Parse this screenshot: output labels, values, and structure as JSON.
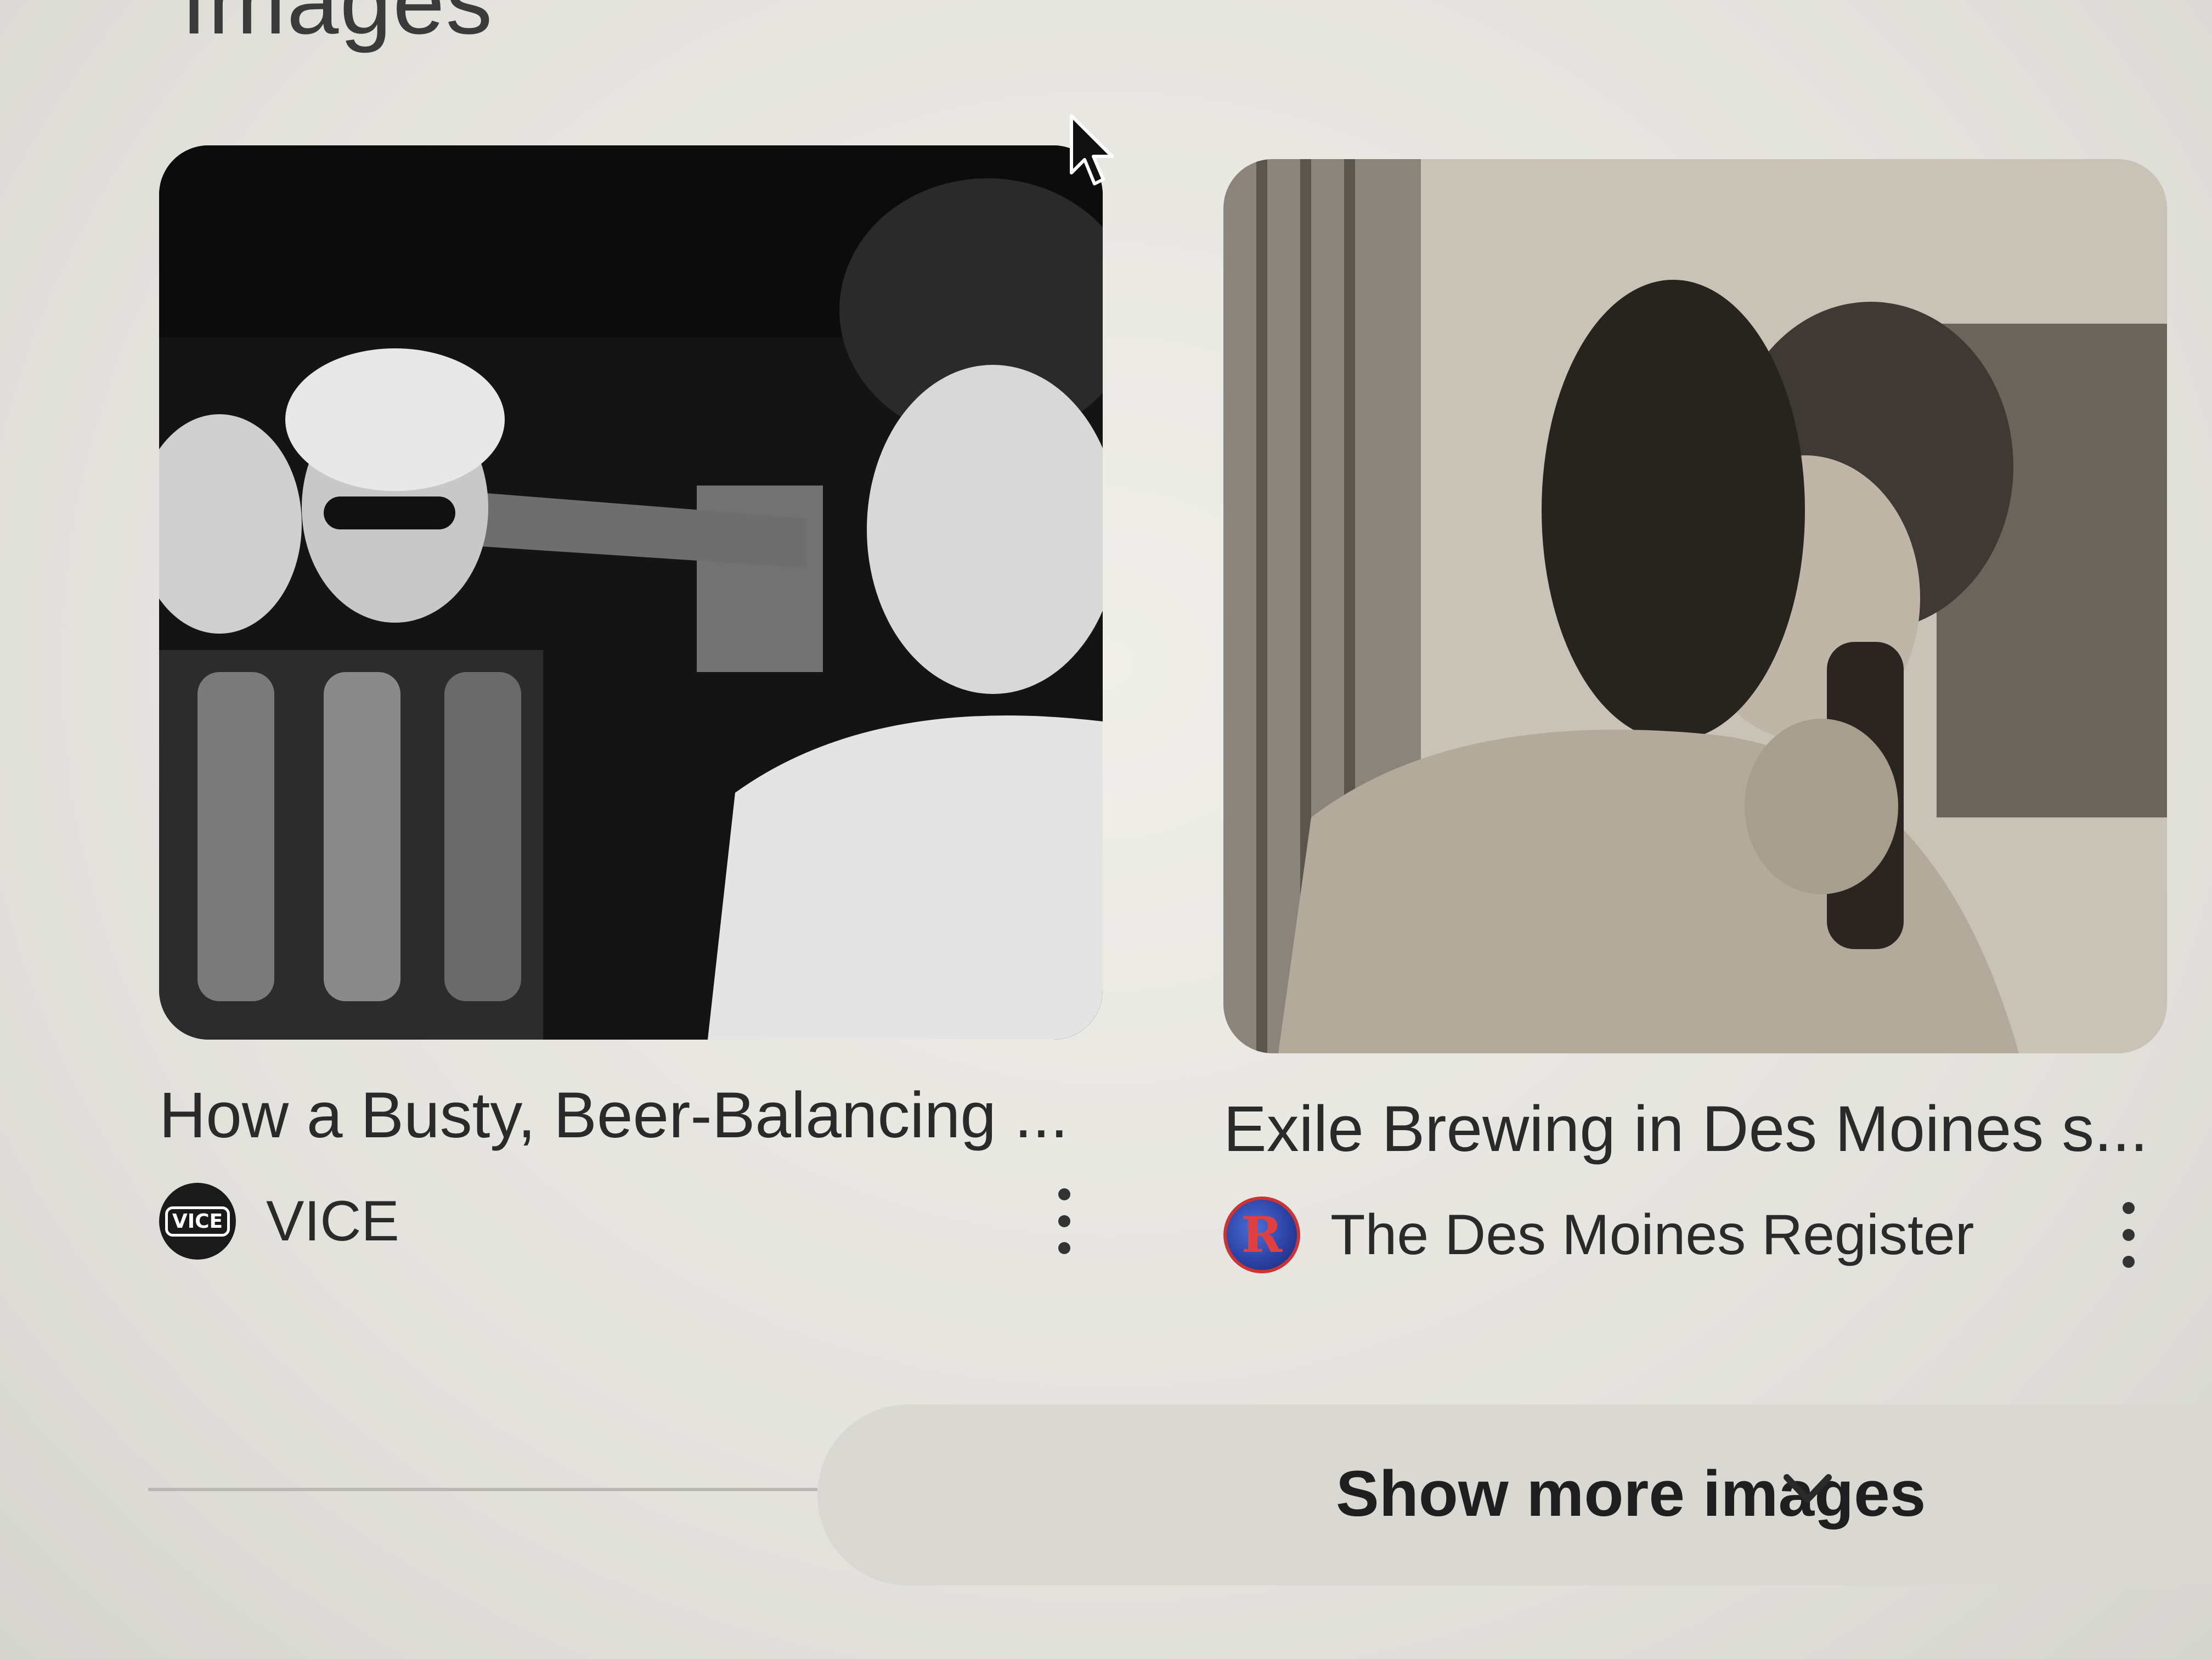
{
  "section": {
    "heading": "Images"
  },
  "results": [
    {
      "title": "How a Busty, Beer-Balancing ...",
      "source": "VICE",
      "favicon_text": "VICE",
      "favicon_icon": "vice-logo-icon"
    },
    {
      "title": "Exile Brewing in Des Moines s...",
      "source": "The Des Moines Register",
      "favicon_text": "R",
      "favicon_icon": "register-logo-icon"
    }
  ],
  "show_more": {
    "label": "Show more images",
    "icon": "chevron-down-icon"
  },
  "colors": {
    "background": "#e7e6e1",
    "text": "#2a2a2a",
    "button_bg": "#d9d8d3"
  }
}
